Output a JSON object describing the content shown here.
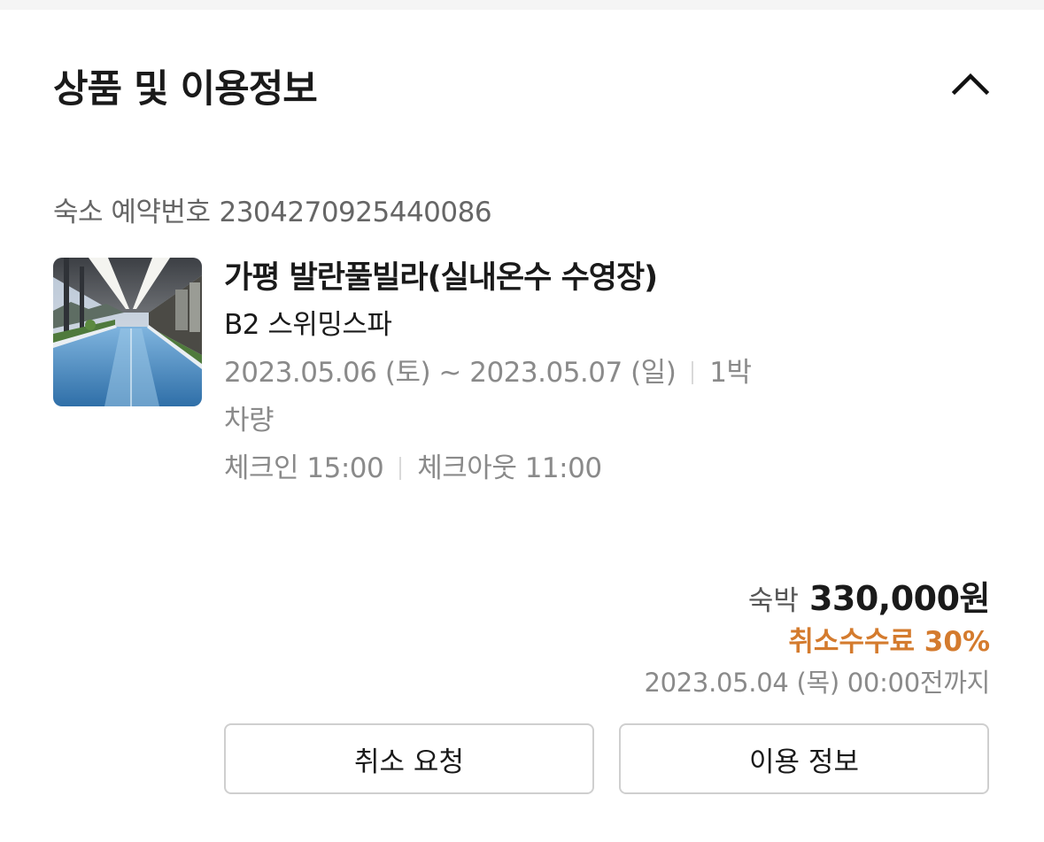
{
  "section": {
    "title": "상품 및 이용정보",
    "collapse_icon": "chevron-up-icon"
  },
  "reservation": {
    "label": "숙소 예약번호",
    "number": "2304270925440086"
  },
  "product": {
    "thumbnail_icon": "pool-photo",
    "name": "가평 발란풀빌라(실내온수 수영장)",
    "room": "B2 스위밍스파",
    "dates": "2023.05.06 (토) ~ 2023.05.07 (일)",
    "nights": "1박",
    "transport": "차량",
    "checkin": "체크인 15:00",
    "checkout": "체크아웃 11:00"
  },
  "price": {
    "label": "숙박",
    "amount": "330,000원",
    "cancel_fee": "취소수수료 30%",
    "deadline": "2023.05.04 (목) 00:00전까지"
  },
  "buttons": {
    "cancel": "취소 요청",
    "info": "이용 정보"
  },
  "colors": {
    "accent_fee": "#d47b2e",
    "muted_text": "#8a8a8a",
    "border": "#cfcfcf"
  }
}
